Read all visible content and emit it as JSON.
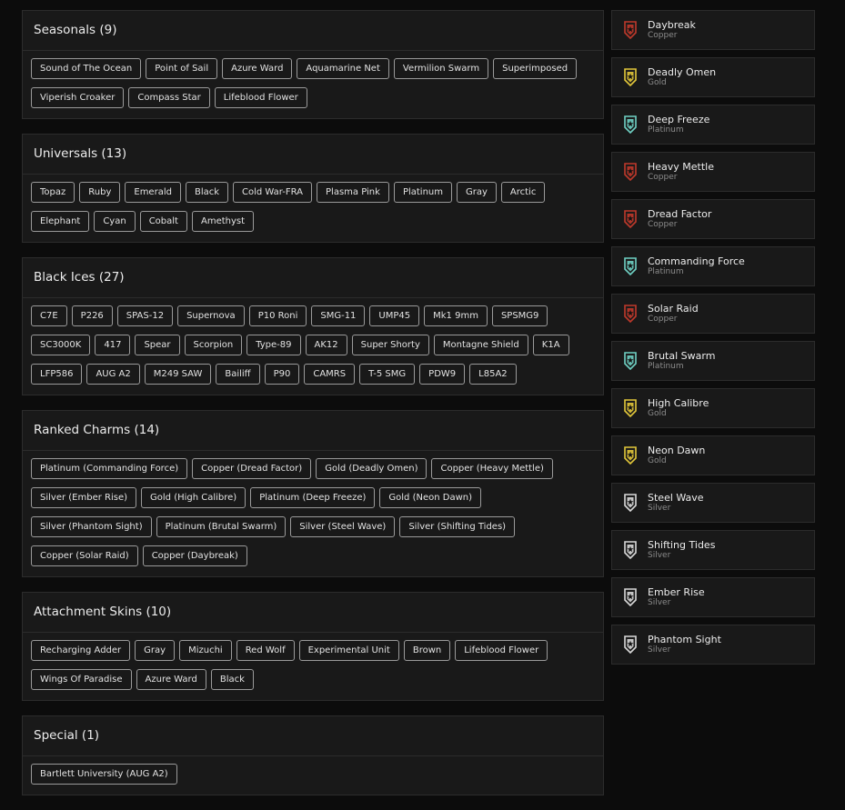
{
  "colors": {
    "copper": "#c0392b",
    "gold": "#e3c83a",
    "platinum": "#6fd1c4",
    "silver": "#d9d9d9"
  },
  "sections": [
    {
      "title": "Seasonals (9)",
      "tags": [
        "Sound of The Ocean",
        "Point of Sail",
        "Azure Ward",
        "Aquamarine Net",
        "Vermilion Swarm",
        "Superimposed",
        "Viperish Croaker",
        "Compass Star",
        "Lifeblood Flower"
      ]
    },
    {
      "title": "Universals (13)",
      "tags": [
        "Topaz",
        "Ruby",
        "Emerald",
        "Black",
        "Cold War-FRA",
        "Plasma Pink",
        "Platinum",
        "Gray",
        "Arctic",
        "Elephant",
        "Cyan",
        "Cobalt",
        "Amethyst"
      ]
    },
    {
      "title": "Black Ices (27)",
      "tags": [
        "C7E",
        "P226",
        "SPAS-12",
        "Supernova",
        "P10 Roni",
        "SMG-11",
        "UMP45",
        "Mk1 9mm",
        "SPSMG9",
        "SC3000K",
        "417",
        "Spear",
        "Scorpion",
        "Type-89",
        "AK12",
        "Super Shorty",
        "Montagne Shield",
        "K1A",
        "LFP586",
        "AUG A2",
        "M249 SAW",
        "Bailiff",
        "P90",
        "CAMRS",
        "T-5 SMG",
        "PDW9",
        "L85A2"
      ]
    },
    {
      "title": "Ranked Charms (14)",
      "tags": [
        "Platinum (Commanding Force)",
        "Copper (Dread Factor)",
        "Gold (Deadly Omen)",
        "Copper (Heavy Mettle)",
        "Silver (Ember Rise)",
        "Gold (High Calibre)",
        "Platinum (Deep Freeze)",
        "Gold (Neon Dawn)",
        "Silver (Phantom Sight)",
        "Platinum (Brutal Swarm)",
        "Silver (Steel Wave)",
        "Silver (Shifting Tides)",
        "Copper (Solar Raid)",
        "Copper (Daybreak)"
      ]
    },
    {
      "title": "Attachment Skins (10)",
      "tags": [
        "Recharging Adder",
        "Gray",
        "Mizuchi",
        "Red Wolf",
        "Experimental Unit",
        "Brown",
        "Lifeblood Flower",
        "Wings Of Paradise",
        "Azure Ward",
        "Black"
      ]
    },
    {
      "title": "Special (1)",
      "tags": [
        "Bartlett University (AUG A2)"
      ]
    }
  ],
  "charms": [
    {
      "name": "Daybreak",
      "tier": "Copper",
      "icon": "copper-rank-icon",
      "color": "#c0392b"
    },
    {
      "name": "Deadly Omen",
      "tier": "Gold",
      "icon": "gold-rank-icon",
      "color": "#e3c83a"
    },
    {
      "name": "Deep Freeze",
      "tier": "Platinum",
      "icon": "platinum-rank-icon",
      "color": "#6fd1c4"
    },
    {
      "name": "Heavy Mettle",
      "tier": "Copper",
      "icon": "copper-rank-icon",
      "color": "#c0392b"
    },
    {
      "name": "Dread Factor",
      "tier": "Copper",
      "icon": "copper-rank-icon",
      "color": "#c0392b"
    },
    {
      "name": "Commanding Force",
      "tier": "Platinum",
      "icon": "platinum-rank-icon",
      "color": "#6fd1c4"
    },
    {
      "name": "Solar Raid",
      "tier": "Copper",
      "icon": "copper-rank-icon",
      "color": "#c0392b"
    },
    {
      "name": "Brutal Swarm",
      "tier": "Platinum",
      "icon": "platinum-rank-icon",
      "color": "#6fd1c4"
    },
    {
      "name": "High Calibre",
      "tier": "Gold",
      "icon": "gold-rank-icon",
      "color": "#e3c83a"
    },
    {
      "name": "Neon Dawn",
      "tier": "Gold",
      "icon": "gold-rank-icon",
      "color": "#e3c83a"
    },
    {
      "name": "Steel Wave",
      "tier": "Silver",
      "icon": "silver-rank-icon",
      "color": "#d9d9d9"
    },
    {
      "name": "Shifting Tides",
      "tier": "Silver",
      "icon": "silver-rank-icon",
      "color": "#d9d9d9"
    },
    {
      "name": "Ember Rise",
      "tier": "Silver",
      "icon": "silver-rank-icon",
      "color": "#d9d9d9"
    },
    {
      "name": "Phantom Sight",
      "tier": "Silver",
      "icon": "silver-rank-icon",
      "color": "#d9d9d9"
    }
  ]
}
